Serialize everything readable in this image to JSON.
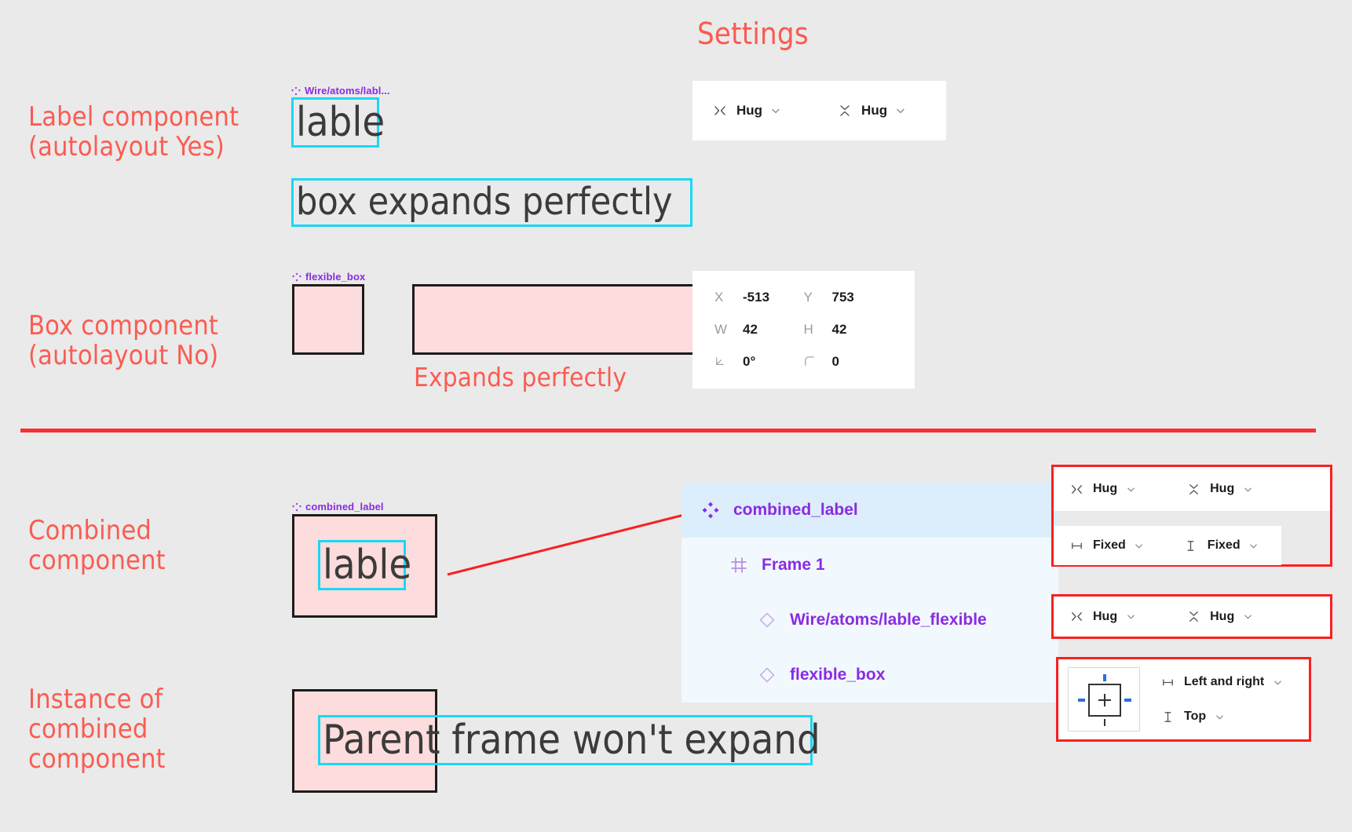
{
  "page": {
    "background": "#eaeaea",
    "accent_red": "#fa5c52",
    "accent_purple": "#8b2be2",
    "accent_cyan": "#18d8f5",
    "pink_fill": "#fcdcdc",
    "highlight_red": "#fa2020"
  },
  "settings": {
    "title": "Settings"
  },
  "sections": {
    "label_component": {
      "annotation": "Label component\n(autolayout Yes)",
      "component_badge": "Wire/atoms/labl...",
      "small_text": "lable",
      "wide_text": "box expands perfectly"
    },
    "box_component": {
      "annotation": "Box component\n(autolayout No)",
      "component_badge": "flexible_box",
      "caption": "Expands perfectly"
    },
    "combined_component": {
      "annotation": "Combined\ncomponent",
      "component_badge": "combined_label",
      "inner_text": "lable"
    },
    "instance_component": {
      "annotation": "Instance of\ncombined\ncomponent",
      "overflow_text": "Parent frame won't expand"
    }
  },
  "label_sizing_panel": {
    "horizontal": {
      "icon": "resize-horizontal-icon",
      "value": "Hug",
      "chevron": "chevron-down-icon"
    },
    "vertical": {
      "icon": "resize-vertical-icon",
      "value": "Hug",
      "chevron": "chevron-down-icon"
    }
  },
  "box_transform_panel": {
    "fields": [
      {
        "key": "X",
        "icon": "x-position-icon",
        "value": "-513"
      },
      {
        "key": "Y",
        "icon": "y-position-icon",
        "value": "753"
      },
      {
        "key": "W",
        "icon": "width-icon",
        "value": "42"
      },
      {
        "key": "H",
        "icon": "height-icon",
        "value": "42"
      },
      {
        "key": "rotation",
        "icon": "rotation-icon",
        "value": "0°"
      },
      {
        "key": "corner-radius",
        "icon": "corner-radius-icon",
        "value": "0"
      }
    ]
  },
  "layers_panel": {
    "rows": [
      {
        "name": "combined_label",
        "icon": "component-icon",
        "depth": 0,
        "selected": true
      },
      {
        "name": "Frame 1",
        "icon": "frame-icon",
        "depth": 1,
        "selected": false
      },
      {
        "name": "Wire/atoms/lable_flexible",
        "icon": "instance-icon",
        "depth": 2,
        "selected": false
      },
      {
        "name": "flexible_box",
        "icon": "instance-icon",
        "depth": 2,
        "selected": false
      }
    ]
  },
  "combined_sizing_panel": {
    "row1": {
      "horizontal": {
        "icon": "resize-horizontal-icon",
        "value": "Hug",
        "chevron": "chevron-down-icon"
      },
      "vertical": {
        "icon": "resize-vertical-icon",
        "value": "Hug",
        "chevron": "chevron-down-icon"
      }
    },
    "row2": {
      "horizontal": {
        "icon": "fixed-width-icon",
        "value": "Fixed",
        "chevron": "chevron-down-icon"
      },
      "vertical": {
        "icon": "fixed-height-icon",
        "value": "Fixed",
        "chevron": "chevron-down-icon"
      }
    }
  },
  "instance_sizing_panel": {
    "horizontal": {
      "icon": "resize-horizontal-icon",
      "value": "Hug",
      "chevron": "chevron-down-icon"
    },
    "vertical": {
      "icon": "resize-vertical-icon",
      "value": "Hug",
      "chevron": "chevron-down-icon"
    }
  },
  "constraints_panel": {
    "widget": "constraints-widget",
    "horizontal": {
      "icon": "fixed-width-icon",
      "value": "Left and right",
      "chevron": "chevron-down-icon"
    },
    "vertical": {
      "icon": "fixed-height-icon",
      "value": "Top",
      "chevron": "chevron-down-icon"
    }
  }
}
